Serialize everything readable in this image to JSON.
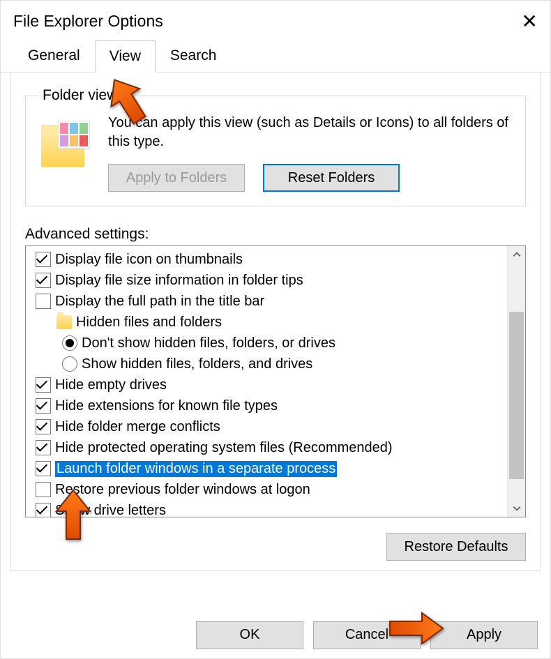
{
  "window": {
    "title": "File Explorer Options"
  },
  "tabs": {
    "general": "General",
    "view": "View",
    "search": "Search"
  },
  "folder_views": {
    "legend": "Folder views",
    "text": "You can apply this view (such as Details or Icons) to all folders of this type.",
    "apply_to_folders": "Apply to Folders",
    "reset_folders": "Reset Folders"
  },
  "advanced_settings": {
    "label": "Advanced settings:",
    "items": [
      {
        "type": "checkbox",
        "checked": true,
        "label": "Display file icon on thumbnails"
      },
      {
        "type": "checkbox",
        "checked": true,
        "label": "Display file size information in folder tips"
      },
      {
        "type": "checkbox",
        "checked": false,
        "label": "Display the full path in the title bar"
      },
      {
        "type": "group",
        "label": "Hidden files and folders"
      },
      {
        "type": "radio",
        "checked": true,
        "label": "Don't show hidden files, folders, or drives"
      },
      {
        "type": "radio",
        "checked": false,
        "label": "Show hidden files, folders, and drives"
      },
      {
        "type": "checkbox",
        "checked": true,
        "label": "Hide empty drives"
      },
      {
        "type": "checkbox",
        "checked": true,
        "label": "Hide extensions for known file types"
      },
      {
        "type": "checkbox",
        "checked": true,
        "label": "Hide folder merge conflicts"
      },
      {
        "type": "checkbox",
        "checked": true,
        "label": "Hide protected operating system files (Recommended)"
      },
      {
        "type": "checkbox",
        "checked": true,
        "label": "Launch folder windows in a separate process",
        "highlight": true
      },
      {
        "type": "checkbox",
        "checked": false,
        "label": "Restore previous folder windows at logon"
      },
      {
        "type": "checkbox",
        "checked": true,
        "label": "Show drive letters"
      }
    ]
  },
  "restore_defaults": "Restore Defaults",
  "buttons": {
    "ok": "OK",
    "cancel": "Cancel",
    "apply": "Apply"
  }
}
